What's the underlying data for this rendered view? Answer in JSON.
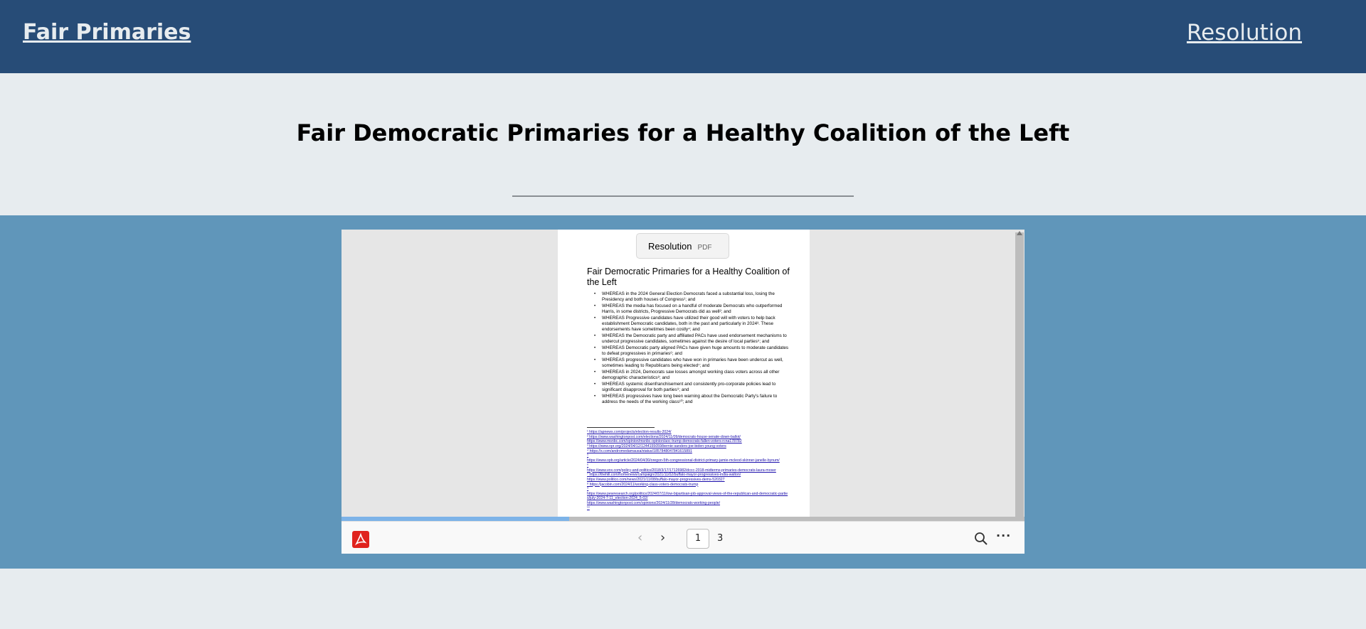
{
  "header": {
    "brand": "Fair Primaries",
    "nav_link": "Resolution"
  },
  "page": {
    "title": "Fair Democratic Primaries for a Healthy Coalition of the Left"
  },
  "pdf_viewer": {
    "chip": {
      "name": "Resolution",
      "type": "PDF"
    },
    "document": {
      "heading": "Fair Democratic Primaries for a Healthy Coalition of the Left",
      "whereas": [
        "WHEREAS in the 2024 General Election Democrats faced a substantial loss, losing the Presidency and both houses of Congress¹; and",
        "WHEREAS the media has focused on a handful of moderate Democrats who outperformed Harris, in some districts, Progressive Democrats did as well²; and",
        "WHEREAS Progressive candidates have utilized their good will with voters to help back establishment Democratic candidates, both in the past and particularly in 2024³. These endorsements have sometimes been costly⁴; and",
        "WHEREAS the Democratic party and affiliated PACs have used endorsement mechanisms to undercut progressive candidates, sometimes against the desire of local parties⁵; and",
        "WHEREAS Democratic party aligned PACs have given huge amounts to moderate candidates to defeat progressives in primaries⁶; and",
        "WHEREAS progressive candidates who have won in primaries have been undercut as well, sometimes leading to Republicans being elected⁷; and",
        "WHEREAS in 2024, Democrats saw losses amongst working class voters across all other demographic characteristics⁸; and",
        "WHEREAS systemic disenfranchisement and consistently pro-corporate policies lead to significant disapproval for both parties⁹; and",
        "WHEREAS progressives have long been warning about the Democratic Party's failure to address the needs of the working class¹⁰; and"
      ],
      "footnotes": [
        "¹ https://apnews.com/projects/election-results-2024/",
        "² https://www.washingtonpost.com/elections/2024/11/09/democrats-house-senate-down-ballot/",
        "https://www.msnbc.com/opinion/msnbc-opinion/aoc-trump-democrats-fallen-voters-rcna178782",
        "³ https://www.npr.org/2024/04/12/1244155059/bernie-sanders-joe-biden-young-voters",
        "⁴ https://x.com/andromedamausa/status/1857848047841615891",
        "⁵",
        "https://www.opb.org/article/2024/04/30/oregon-5th-congressional-district-primary-jamie-mcleod-skinner-janelle-bynum/",
        "⁶",
        "https://www.vox.com/policy-and-politics/2018/3/17/17126982/dccc-2018-midterms-primaries-democrats-laura-moser",
        "⁷ https://thehill.com/homenews/campaign/2021/11/02/buffalo-mayor-progressives-india-walton/",
        "https://www.politico.com/news/2021/11/08/buffalo-mayor-progressives-dems-520327",
        "⁸ https://jacobin.com/2024/11/working-class-voters-democrats-trump",
        "⁹",
        "https://www.pewresearch.org/politics/2024/07/11/low-bipartisan-job-approval-views-of-the-republican-and-democratic-parties/july-2024-7-11_election-2024_5-02/",
        "https://www.washingtonpost.com/opinions/2024/11/28/democrats-working-people/",
        "¹⁰"
      ]
    },
    "toolbar": {
      "current_page": "1",
      "total_pages": "3",
      "brand_color": "#e0231e"
    }
  },
  "colors": {
    "header_bg": "#274c77",
    "page_bg": "#e7ecef",
    "band_bg": "#6096ba"
  }
}
